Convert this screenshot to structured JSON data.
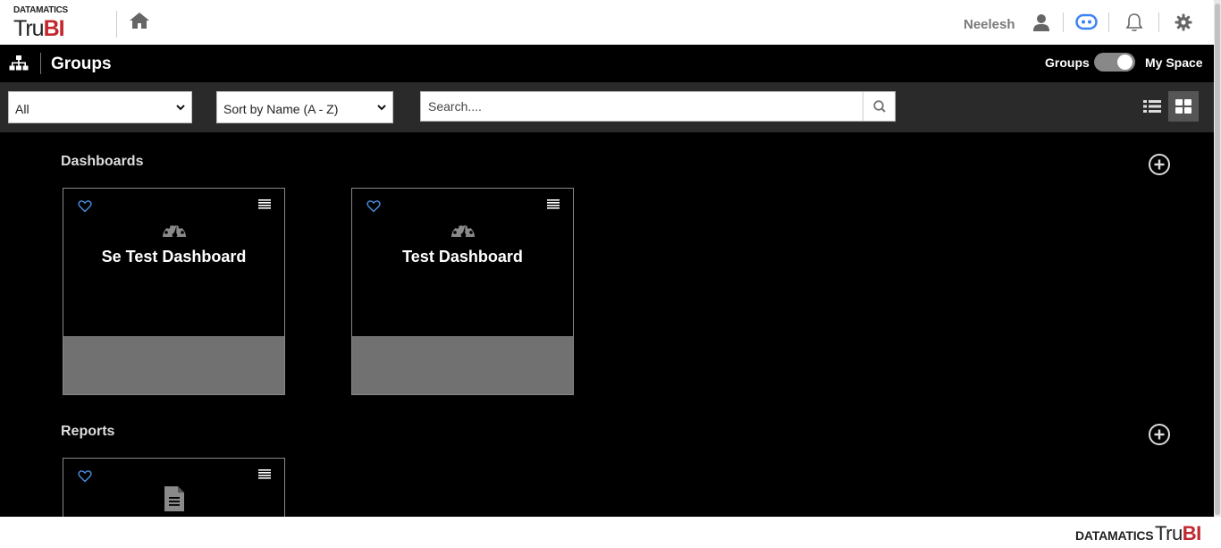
{
  "brand": {
    "company": "DATAMATICS",
    "product_a": "Tru",
    "product_b": "BI"
  },
  "topbar": {
    "username": "Neelesh"
  },
  "header": {
    "title": "Groups",
    "toggle_left_label": "Groups",
    "toggle_right_label": "My Space",
    "toggle_state": "My Space"
  },
  "filters": {
    "type_select": {
      "selected": "All"
    },
    "sort_select": {
      "selected": "Sort by Name (A - Z)"
    },
    "search": {
      "placeholder": "Search....",
      "value": ""
    },
    "view_mode": "grid"
  },
  "sections": {
    "dashboards": {
      "title": "Dashboards",
      "items": [
        {
          "title": "Se Test Dashboard",
          "icon": "dashboard-gauge-icon"
        },
        {
          "title": "Test Dashboard",
          "icon": "dashboard-gauge-icon"
        }
      ]
    },
    "reports": {
      "title": "Reports",
      "items": [
        {
          "title": "",
          "icon": "report-document-icon"
        }
      ]
    }
  },
  "footer": {
    "company": "DATAMATICS",
    "product_a": "Tru",
    "product_b": "BI"
  },
  "colors": {
    "accent_red": "#c1272d",
    "chat_blue": "#3b82f6",
    "favorite_blue": "#4a90e2"
  }
}
